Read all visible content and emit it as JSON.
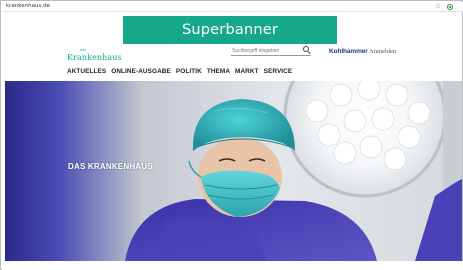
{
  "browser": {
    "url": "krankenhaus.de",
    "star_icon": "star-icon",
    "extension_icon": "extension-icon"
  },
  "ad": {
    "superbanner_label": "Superbanner",
    "color": "#16a88c"
  },
  "header": {
    "logo_small": "das",
    "logo_main": "Krankenhaus",
    "search_placeholder": "Suchbegriff eingeben",
    "publisher": "Kohlhammer",
    "login": "Anmelden"
  },
  "nav": {
    "items": [
      "AKTUELLES",
      "ONLINE-AUSGABE",
      "POLITIK",
      "THEMA",
      "MARKT",
      "SERVICE"
    ]
  },
  "hero": {
    "title": "DAS KRANKENHAUS",
    "image": "surgeon-with-cap-and-mask-under-operating-lamp"
  },
  "colors": {
    "brand": "#16a88c",
    "publisher": "#1b3c7d",
    "scrubs": "#4b3fb0"
  }
}
